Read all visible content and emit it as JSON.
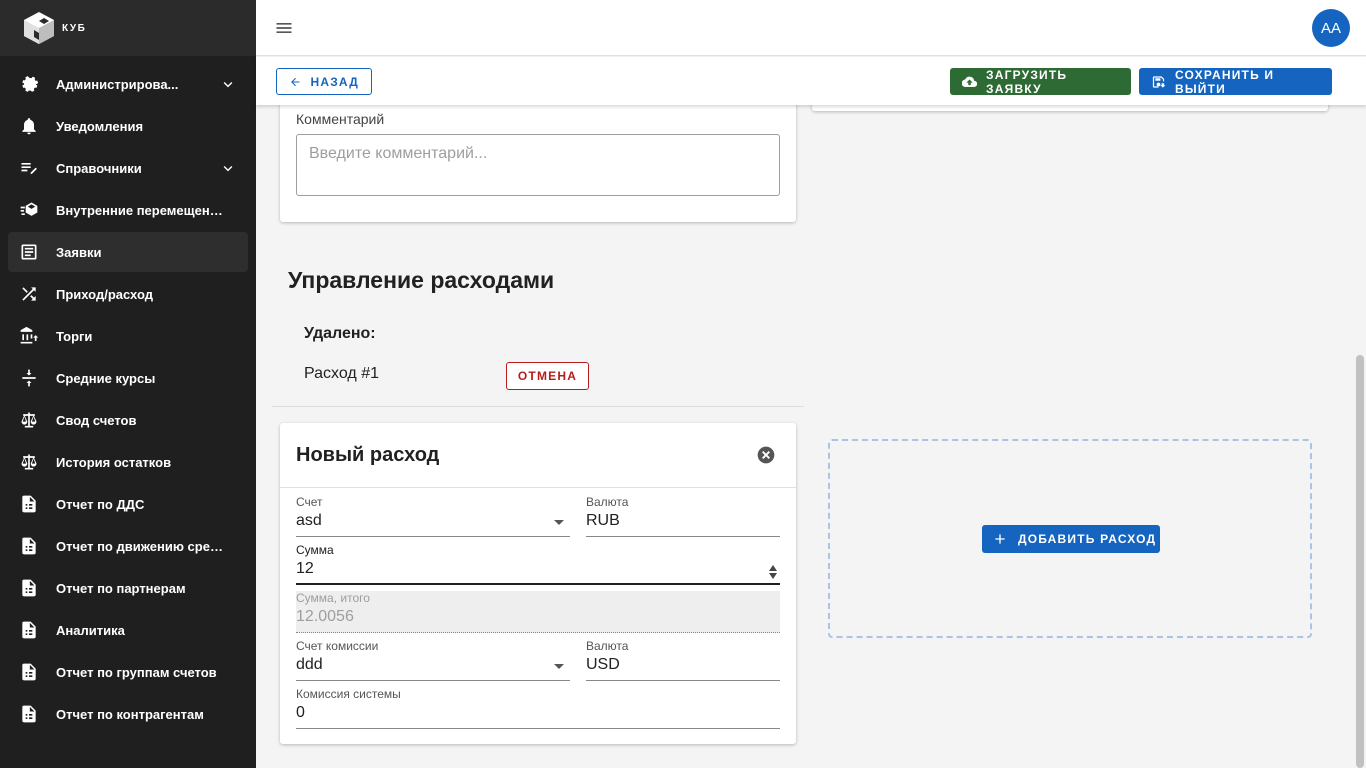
{
  "app": {
    "logo_text": "КУБ"
  },
  "sidebar": {
    "items": [
      {
        "label": "Администрирова...",
        "icon": "admin-gear-icon",
        "has_children": true
      },
      {
        "label": "Уведомления",
        "icon": "bell-icon"
      },
      {
        "label": "Справочники",
        "icon": "edit-list-icon",
        "has_children": true
      },
      {
        "label": "Внутренние перемещения",
        "icon": "box-move-icon"
      },
      {
        "label": "Заявки",
        "icon": "document-icon",
        "active": true
      },
      {
        "label": "Приход/расход",
        "icon": "shuffle-icon"
      },
      {
        "label": "Торги",
        "icon": "bank-icon"
      },
      {
        "label": "Средние курсы",
        "icon": "compress-icon"
      },
      {
        "label": "Свод счетов",
        "icon": "scale-icon"
      },
      {
        "label": "История остатков",
        "icon": "scale-icon"
      },
      {
        "label": "Отчет по ДДС",
        "icon": "report-icon"
      },
      {
        "label": "Отчет по движению сред...",
        "icon": "report-icon"
      },
      {
        "label": "Отчет по партнерам",
        "icon": "report-icon"
      },
      {
        "label": "Аналитика",
        "icon": "report-icon"
      },
      {
        "label": "Отчет по группам счетов",
        "icon": "report-icon"
      },
      {
        "label": "Отчет по контрагентам",
        "icon": "report-icon"
      }
    ]
  },
  "header": {
    "avatar": "AA"
  },
  "toolbar": {
    "back_label": "НАЗАД",
    "upload_label": "ЗАГРУЗИТЬ ЗАЯВКУ",
    "save_label": "СОХРАНИТЬ И ВЫЙТИ"
  },
  "comment": {
    "label": "Комментарий",
    "placeholder": "Введите комментарий..."
  },
  "expenses": {
    "title": "Управление расходами",
    "deleted_title": "Удалено:",
    "deleted_item": "Расход #1",
    "cancel_label": "ОТМЕНА",
    "add_label": "ДОБАВИТЬ РАСХОД"
  },
  "new_expense": {
    "title": "Новый расход",
    "account": {
      "label": "Счет",
      "value": "asd"
    },
    "currency": {
      "label": "Валюта",
      "value": "RUB"
    },
    "amount": {
      "label": "Сумма",
      "value": "12"
    },
    "total": {
      "label": "Сумма, итого",
      "value": "12.0056"
    },
    "fee_account": {
      "label": "Счет комиссии",
      "value": "ddd"
    },
    "fee_currency": {
      "label": "Валюта",
      "value": "USD"
    },
    "system_fee": {
      "label": "Комиссия системы",
      "value": "0"
    }
  },
  "colors": {
    "primary": "#1565c0",
    "success": "#2e6b34",
    "danger": "#b71c1c",
    "sidebar_bg": "#1f1f1f"
  }
}
